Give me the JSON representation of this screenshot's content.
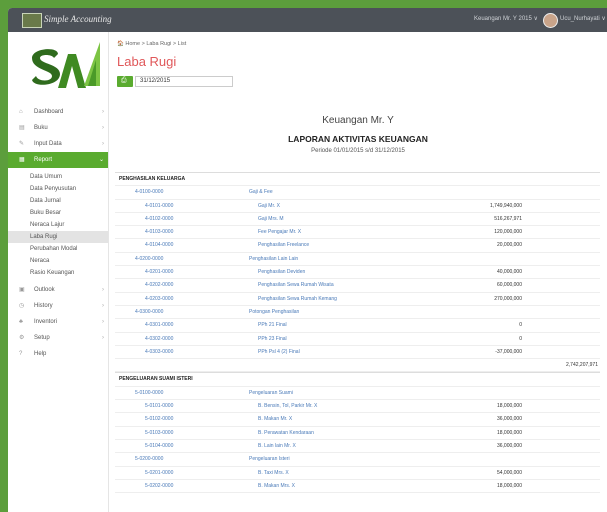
{
  "topbar": {
    "brand": "Simple Accounting",
    "company_menu": "Keuangan Mr. Y 2015 ∨",
    "user_menu": "Ucu_Nurhayati ∨"
  },
  "sidebar": {
    "items": [
      {
        "label": "Dashboard",
        "icon": "home-icon"
      },
      {
        "label": "Buku",
        "icon": "book-icon"
      },
      {
        "label": "Input Data",
        "icon": "edit-icon"
      },
      {
        "label": "Report",
        "icon": "report-icon"
      }
    ],
    "report_sub": [
      "Data Umum",
      "Data Penyusutan",
      "Data Jurnal",
      "Buku Besar",
      "Neraca Lajur",
      "Laba Rugi",
      "Perubahan Modal",
      "Neraca",
      "Rasio Keuangan"
    ],
    "items_after": [
      {
        "label": "Outlook",
        "icon": "calendar-icon"
      },
      {
        "label": "History",
        "icon": "history-icon"
      },
      {
        "label": "Inventori",
        "icon": "users-icon"
      },
      {
        "label": "Setup",
        "icon": "settings-icon"
      },
      {
        "label": "Help",
        "icon": "help-icon"
      }
    ]
  },
  "main": {
    "breadcrumb": "🏠 Home > Laba Rugi > List",
    "title": "Laba Rugi",
    "date_value": "31/12/2015"
  },
  "report": {
    "company": "Keuangan Mr. Y",
    "title": "LAPORAN AKTIVITAS KEUANGAN",
    "period": "Periode 01/01/2015 s/d 31/12/2015",
    "section1": "PENGHASILAN KELUARGA",
    "section2": "PENGELUARAN SUAMI ISTERI",
    "rows1": [
      {
        "code": "4-0100-0000",
        "name": "Gaji & Fee",
        "amount": "",
        "lvl": 1
      },
      {
        "code": "4-0101-0000",
        "name": "Gaji Mr. X",
        "amount": "1,749,940,000",
        "lvl": 2
      },
      {
        "code": "4-0102-0000",
        "name": "Gaji Mrs. M",
        "amount": "516,267,971",
        "lvl": 2
      },
      {
        "code": "4-0103-0000",
        "name": "Fee Pengajar Mr. X",
        "amount": "120,000,000",
        "lvl": 2
      },
      {
        "code": "4-0104-0000",
        "name": "Penghasilan Freelance",
        "amount": "20,000,000",
        "lvl": 2
      },
      {
        "code": "4-0200-0000",
        "name": "Penghasilan Lain Lain",
        "amount": "",
        "lvl": 1
      },
      {
        "code": "4-0201-0000",
        "name": "Penghasilan Deviden",
        "amount": "40,000,000",
        "lvl": 2
      },
      {
        "code": "4-0202-0000",
        "name": "Penghasilan Sewa Rumah Wisata",
        "amount": "60,000,000",
        "lvl": 2
      },
      {
        "code": "4-0203-0000",
        "name": "Penghasilan Sewa Rumah Kemang",
        "amount": "270,000,000",
        "lvl": 2
      },
      {
        "code": "4-0300-0000",
        "name": "Potongan Penghasilan",
        "amount": "",
        "lvl": 1
      },
      {
        "code": "4-0301-0000",
        "name": "PPh 21 Final",
        "amount": "0",
        "lvl": 2
      },
      {
        "code": "4-0302-0000",
        "name": "PPh 23 Final",
        "amount": "0",
        "lvl": 2
      },
      {
        "code": "4-0303-0000",
        "name": "PPh Psl 4 (2) Final",
        "amount": "-37,000,000",
        "lvl": 2
      }
    ],
    "total1": "2,742,207,971",
    "rows2": [
      {
        "code": "5-0100-0000",
        "name": "Pengeluaran Suami",
        "amount": "",
        "lvl": 1
      },
      {
        "code": "5-0101-0000",
        "name": "B. Bensin, Tol, Parkir Mr. X",
        "amount": "18,000,000",
        "lvl": 2
      },
      {
        "code": "5-0102-0000",
        "name": "B. Makan Mr. X",
        "amount": "36,000,000",
        "lvl": 2
      },
      {
        "code": "5-0103-0000",
        "name": "B. Perawatan Kendaraan",
        "amount": "18,000,000",
        "lvl": 2
      },
      {
        "code": "5-0104-0000",
        "name": "B. Lain lain Mr. X",
        "amount": "36,000,000",
        "lvl": 2
      },
      {
        "code": "5-0200-0000",
        "name": "Pengeluaran Isteri",
        "amount": "",
        "lvl": 1
      },
      {
        "code": "5-0201-0000",
        "name": "B. Taxi Mrs. X",
        "amount": "54,000,000",
        "lvl": 2
      },
      {
        "code": "5-0202-0000",
        "name": "B. Makan Mrs. X",
        "amount": "18,000,000",
        "lvl": 2
      }
    ]
  },
  "colors": {
    "accent": "#5aab2f",
    "title": "#e0585a",
    "topbar": "#4c5158",
    "link": "#4a7ab8"
  }
}
